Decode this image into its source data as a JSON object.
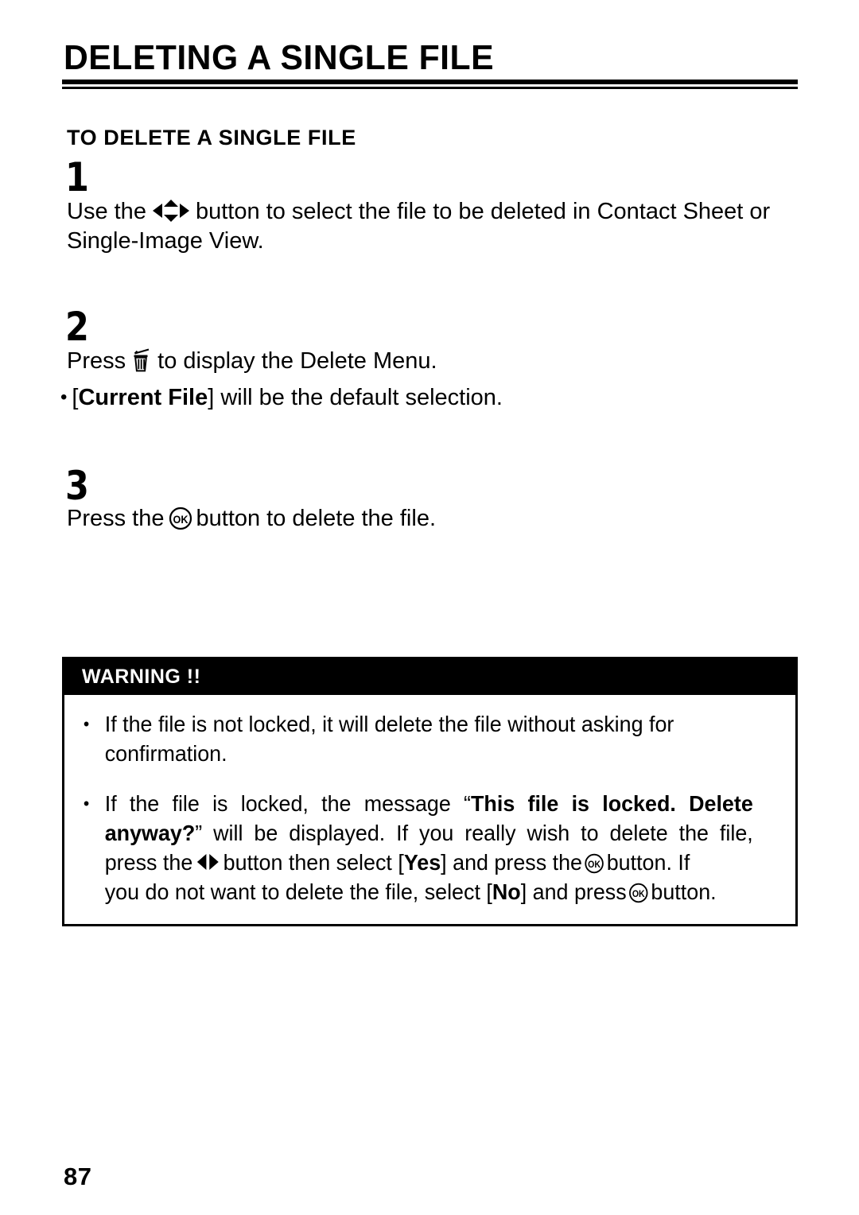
{
  "document": {
    "title": "DELETING A SINGLE FILE",
    "subheading": "TO DELETE A SINGLE FILE",
    "page_number": "87"
  },
  "steps": [
    {
      "number": "1",
      "text_before_icon": "Use the",
      "icon": "four-way-arrow-icon",
      "text_after_icon": "button to select the file to be deleted in Contact Sheet or",
      "text_last_line": "Single-Image View."
    },
    {
      "number": "2",
      "text_before_icon": "Press",
      "icon": "trash-icon",
      "text_after_icon": "to display the Delete Menu.",
      "bullet": {
        "dot": "•",
        "bracket_open": "[",
        "bold_label": "Current File",
        "bracket_close": "]",
        "text_after": " will be the default selection."
      }
    },
    {
      "number": "3",
      "text_before_icon": "Press the",
      "icon": "ok-button-icon",
      "text_after_icon": "button to delete the file."
    }
  ],
  "warning": {
    "header": "WARNING !!",
    "items": [
      {
        "dot": "•",
        "text": "If the file is not locked, it will delete the file without asking for",
        "text_last_line": "confirmation."
      },
      {
        "dot": "•",
        "part1": "If the file is locked, the message “",
        "bold1": "This file is locked. Delete",
        "bold2": "anyway?",
        "part2": "” will be displayed. If you really wish to delete the file,",
        "part3": "press the",
        "icon1": "left-right-arrow-icon",
        "part4": "button then select",
        "bracket_open1": "[",
        "bold3": "Yes",
        "bracket_close1": "]",
        "part5": "and press the",
        "icon2": "ok-button-icon",
        "part6": "button. If",
        "part7": "you do not want to delete the file, select ",
        "bracket_open2": "[",
        "bold4": "No",
        "bracket_close2": "]",
        "part8": " and press",
        "icon3": "ok-button-icon",
        "part9": "button."
      }
    ]
  },
  "icons": {
    "ok_label": "OK"
  },
  "colors": {
    "ink": "#000000",
    "paper": "#ffffff",
    "warning_header_bg": "#000000",
    "warning_header_fg": "#ffffff"
  }
}
